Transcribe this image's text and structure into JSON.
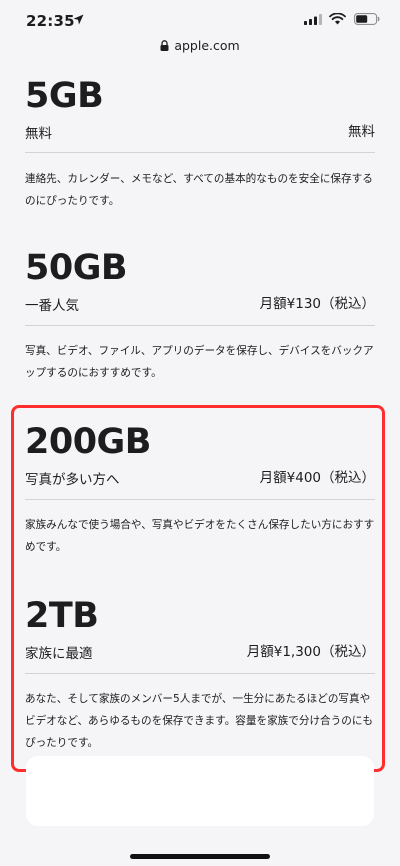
{
  "status": {
    "time": "22:35"
  },
  "browser": {
    "url": "apple.com"
  },
  "plans": [
    {
      "size": "5GB",
      "subtitle": "無料",
      "price": "無料",
      "description": "連絡先、カレンダー、メモなど、すべての基本的なものを安全に保存するのにぴったりです。"
    },
    {
      "size": "50GB",
      "subtitle": "一番人気",
      "price": "月額¥130（税込）",
      "description": "写真、ビデオ、ファイル、アプリのデータを保存し、デバイスをバックアップするのにおすすめです。"
    },
    {
      "size": "200GB",
      "subtitle": "写真が多い方へ",
      "price": "月額¥400（税込）",
      "description": "家族みんなで使う場合や、写真やビデオをたくさん保存したい方におすすめです。"
    },
    {
      "size": "2TB",
      "subtitle": "家族に最適",
      "price": "月額¥1,300（税込）",
      "description": "あなた、そして家族のメンバー5人までが、一生分にあたるほどの写真やビデオなど、あらゆるものを保存できます。容量を家族で分け合うのにもぴったりです。"
    }
  ],
  "colors": {
    "highlight": "#ff2d2d",
    "rule": "#d2d2d7",
    "background": "#f5f5f7"
  },
  "icons": [
    "location-arrow-icon",
    "signal-icon",
    "wifi-icon",
    "battery-icon",
    "lock-icon"
  ]
}
